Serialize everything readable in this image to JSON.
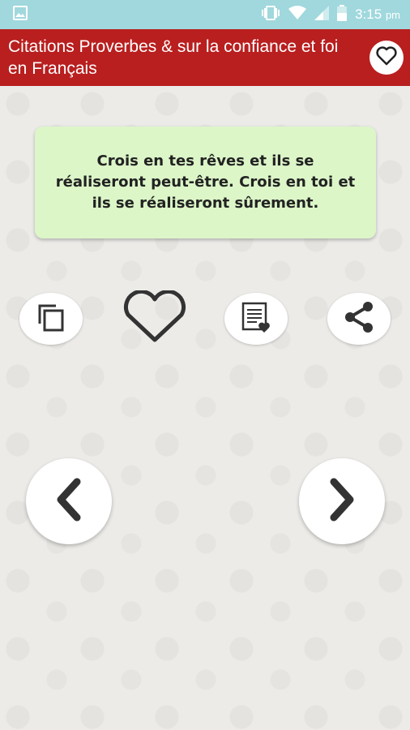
{
  "status_bar": {
    "time": "3:15",
    "ampm": "pm",
    "icons": [
      "image-icon",
      "vibrate-icon",
      "wifi-icon",
      "signal-icon",
      "battery-icon"
    ]
  },
  "app_bar": {
    "title": "Citations Proverbes & sur la confiance et foi en Français",
    "favorites_icon": "heart-outline-icon"
  },
  "quote": {
    "text": "Crois en tes rêves et ils se réaliseront peut-être. Crois en toi et ils se réaliseront sûrement."
  },
  "actions": [
    {
      "name": "copy",
      "icon": "copy-icon"
    },
    {
      "name": "favorite",
      "icon": "heart-outline-icon"
    },
    {
      "name": "favorites-list",
      "icon": "list-heart-icon"
    },
    {
      "name": "share",
      "icon": "share-icon"
    }
  ],
  "navigation": {
    "previous_icon": "chevron-left-icon",
    "next_icon": "chevron-right-icon"
  },
  "colors": {
    "status_bar": "#a0d8dd",
    "app_bar": "#b91f1f",
    "quote_card": "#dcf6c8",
    "background": "#ecebe8"
  }
}
